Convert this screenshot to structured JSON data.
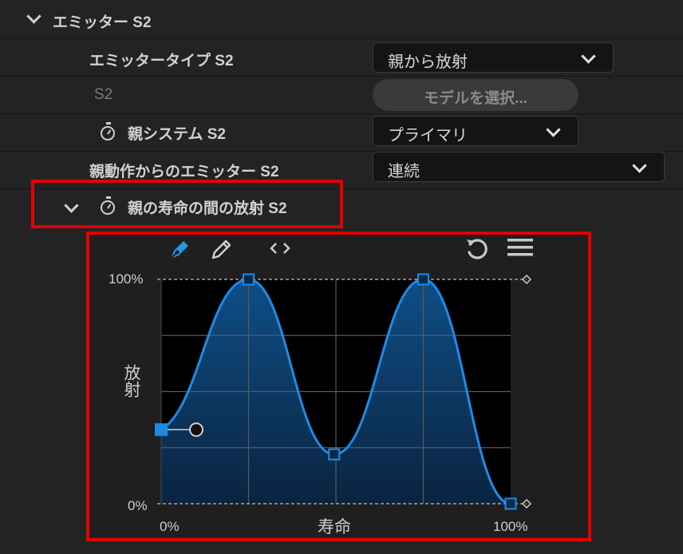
{
  "section": {
    "title": "エミッター S2"
  },
  "rows": {
    "emitter_type": {
      "label": "エミッタータイプ S2",
      "value": "親から放射"
    },
    "model": {
      "label": "S2",
      "button": "モデルを選択..."
    },
    "parent_system": {
      "label": "親システム S2",
      "value": "プライマリ"
    },
    "parent_motion": {
      "label": "親動作からのエミッター S2",
      "value": "連続"
    },
    "lifetime_emission": {
      "label": "親の寿命の間の放射 S2"
    }
  },
  "curve_editor": {
    "y_max_label": "100%",
    "y_min_label": "0%",
    "x_min_label": "0%",
    "x_max_label": "100%",
    "x_axis_title": "寿命",
    "y_axis_title": "放射",
    "toolbar": {
      "pen_tool": "pen-icon",
      "pencil_tool": "pencil-icon",
      "code_tool": "code-icon",
      "reset": "reset-icon",
      "menu": "menu-icon"
    },
    "colors": {
      "curve": "#1f8ae6",
      "fill_top": "#0f4e86",
      "fill_bottom": "#0a2440",
      "highlight": "#e20000"
    }
  },
  "chart_data": {
    "type": "line",
    "xlabel": "寿命",
    "ylabel": "放射",
    "xlim": [
      0,
      100
    ],
    "ylim": [
      0,
      100
    ],
    "grid": true,
    "x": [
      0,
      25,
      49.5,
      75,
      100
    ],
    "values": [
      33,
      100,
      22,
      100,
      0
    ]
  }
}
